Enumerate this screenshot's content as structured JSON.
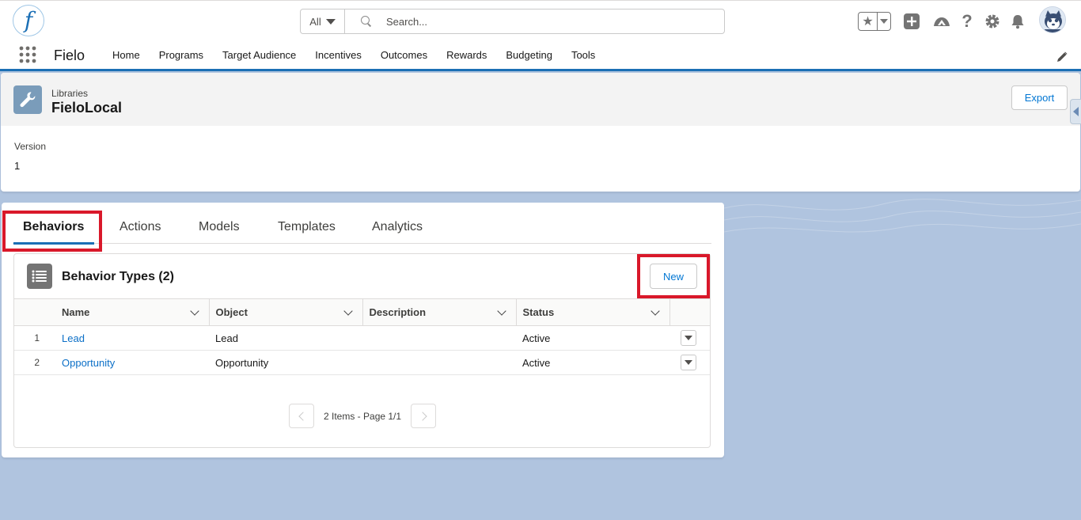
{
  "header": {
    "logo_letter": "f",
    "search_scope": "All",
    "search_placeholder": "Search...",
    "icons": [
      "favorites-star-icon",
      "global-actions-icon",
      "trailhead-icon",
      "help-icon",
      "setup-gear-icon",
      "notifications-bell-icon",
      "user-avatar"
    ]
  },
  "nav": {
    "app_name": "Fielo",
    "items": [
      "Home",
      "Programs",
      "Target Audience",
      "Incentives",
      "Outcomes",
      "Rewards",
      "Budgeting",
      "Tools"
    ]
  },
  "record": {
    "object_type": "Libraries",
    "title": "FieloLocal",
    "export_label": "Export",
    "fields": [
      {
        "label": "Version",
        "value": "1"
      }
    ]
  },
  "tabs": [
    "Behaviors",
    "Actions",
    "Models",
    "Templates",
    "Analytics"
  ],
  "active_tab": "Behaviors",
  "related_list": {
    "title": "Behavior Types (2)",
    "new_label": "New",
    "columns": [
      "Name",
      "Object",
      "Description",
      "Status"
    ],
    "rows": [
      {
        "num": "1",
        "name": "Lead",
        "object": "Lead",
        "description": "",
        "status": "Active"
      },
      {
        "num": "2",
        "name": "Opportunity",
        "object": "Opportunity",
        "description": "",
        "status": "Active"
      }
    ],
    "pager_text": "2 Items - Page 1/1"
  },
  "colors": {
    "brand_blue": "#1b6fb5",
    "link_blue": "#0b6fc7",
    "highlight_red": "#d9182a",
    "page_bg": "#b0c4df"
  }
}
